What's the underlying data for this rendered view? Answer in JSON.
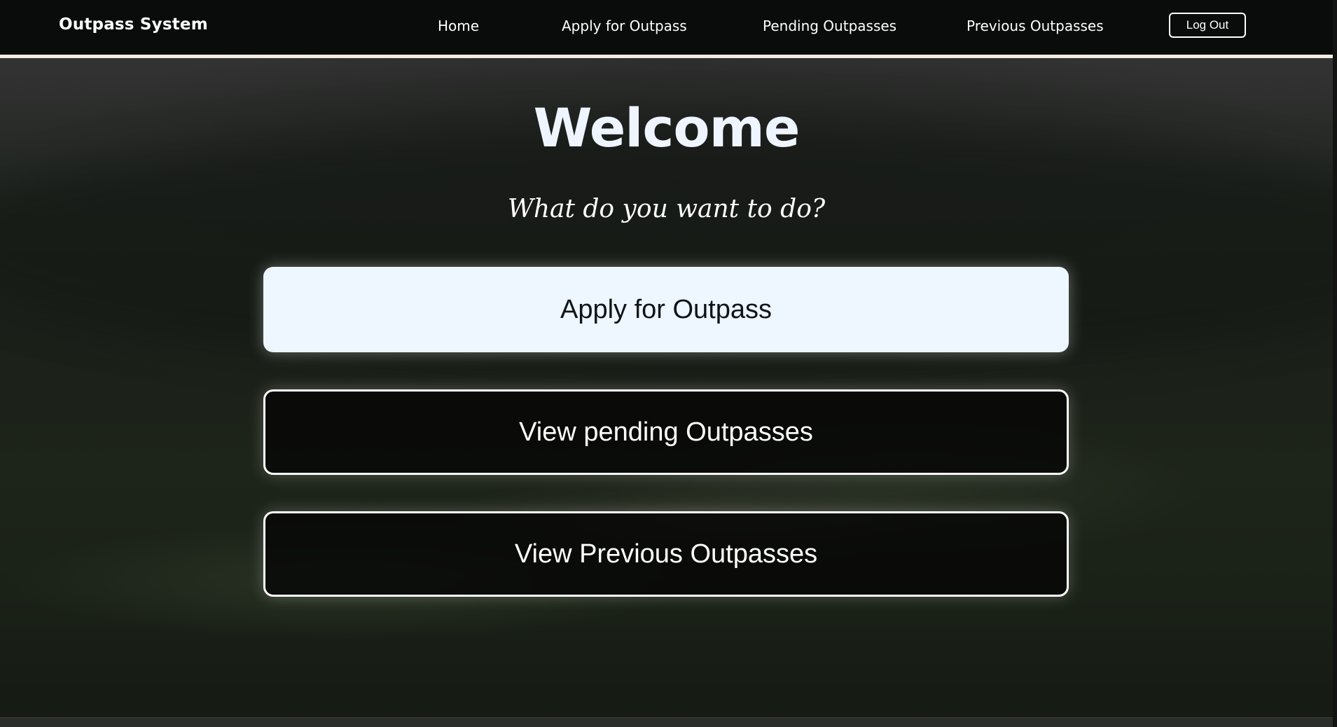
{
  "nav": {
    "brand": "Outpass System",
    "links": [
      {
        "label": "Home"
      },
      {
        "label": "Apply for Outpass"
      },
      {
        "label": "Pending Outpasses"
      },
      {
        "label": "Previous Outpasses"
      }
    ],
    "logout_label": "Log Out"
  },
  "main": {
    "heading": "Welcome",
    "subtitle": "What do you want to do?",
    "actions": [
      {
        "label": "Apply for Outpass"
      },
      {
        "label": "View pending Outpasses"
      },
      {
        "label": "View Previous Outpasses"
      }
    ]
  },
  "colors": {
    "nav_background": "#0a0b0b",
    "nav_border": "#f3ece0",
    "primary_button": "#eef6ff",
    "heading": "#eef5ff"
  }
}
